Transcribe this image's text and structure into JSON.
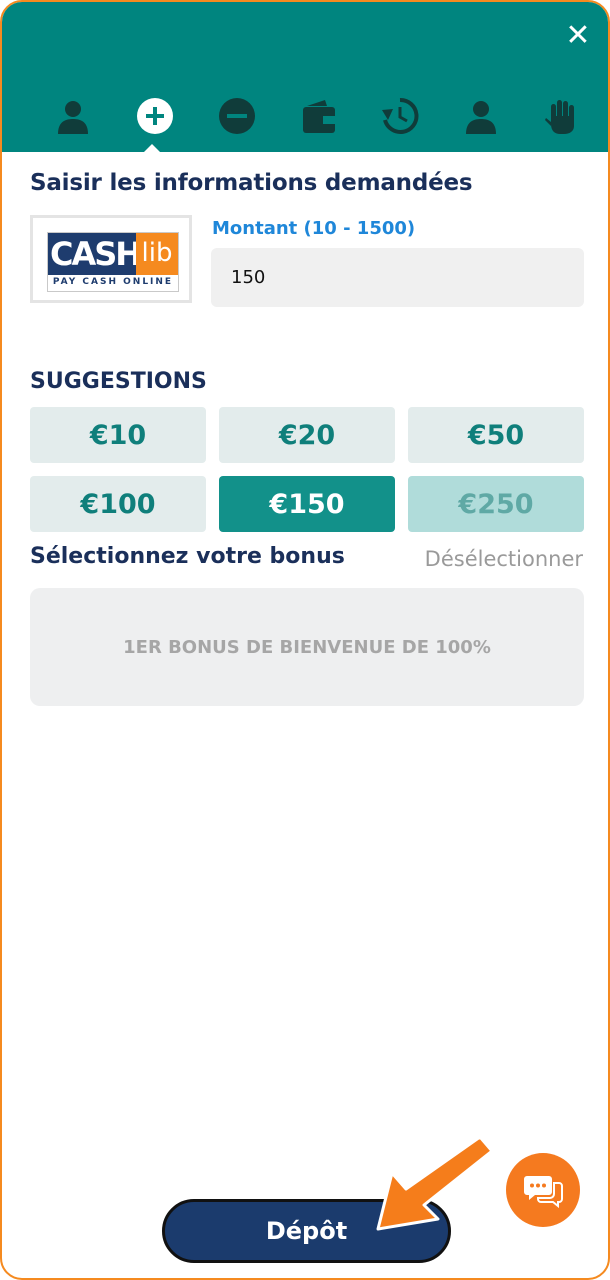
{
  "header": {
    "close_label": "✕",
    "tabs": [
      {
        "icon": "user-icon"
      },
      {
        "icon": "plus-circle-icon",
        "active": true
      },
      {
        "icon": "minus-circle-icon"
      },
      {
        "icon": "wallet-icon"
      },
      {
        "icon": "history-icon"
      },
      {
        "icon": "profile-icon"
      },
      {
        "icon": "hand-icon"
      }
    ]
  },
  "form": {
    "section_title": "Saisir les informations demandées",
    "payment_logo": {
      "main": "CASH",
      "suffix": "lib",
      "tagline": "PAY CASH ONLINE"
    },
    "amount_label": "Montant (10 - 1500)",
    "amount_value": "150"
  },
  "suggestions": {
    "title": "SUGGESTIONS",
    "items": [
      {
        "label": "€10"
      },
      {
        "label": "€20"
      },
      {
        "label": "€50"
      },
      {
        "label": "€100"
      },
      {
        "label": "€150",
        "selected": true
      },
      {
        "label": "€250",
        "disabled": true
      }
    ]
  },
  "bonus": {
    "title": "Sélectionnez votre bonus",
    "deselect_label": "Désélectionner",
    "option": "1ER BONUS DE BIENVENUE DE 100%"
  },
  "actions": {
    "deposit_label": "Dépôt"
  },
  "colors": {
    "accent": "#00857f",
    "brand_navy": "#1b3b6d",
    "orange": "#f58a1f",
    "selected": "#12918a"
  }
}
